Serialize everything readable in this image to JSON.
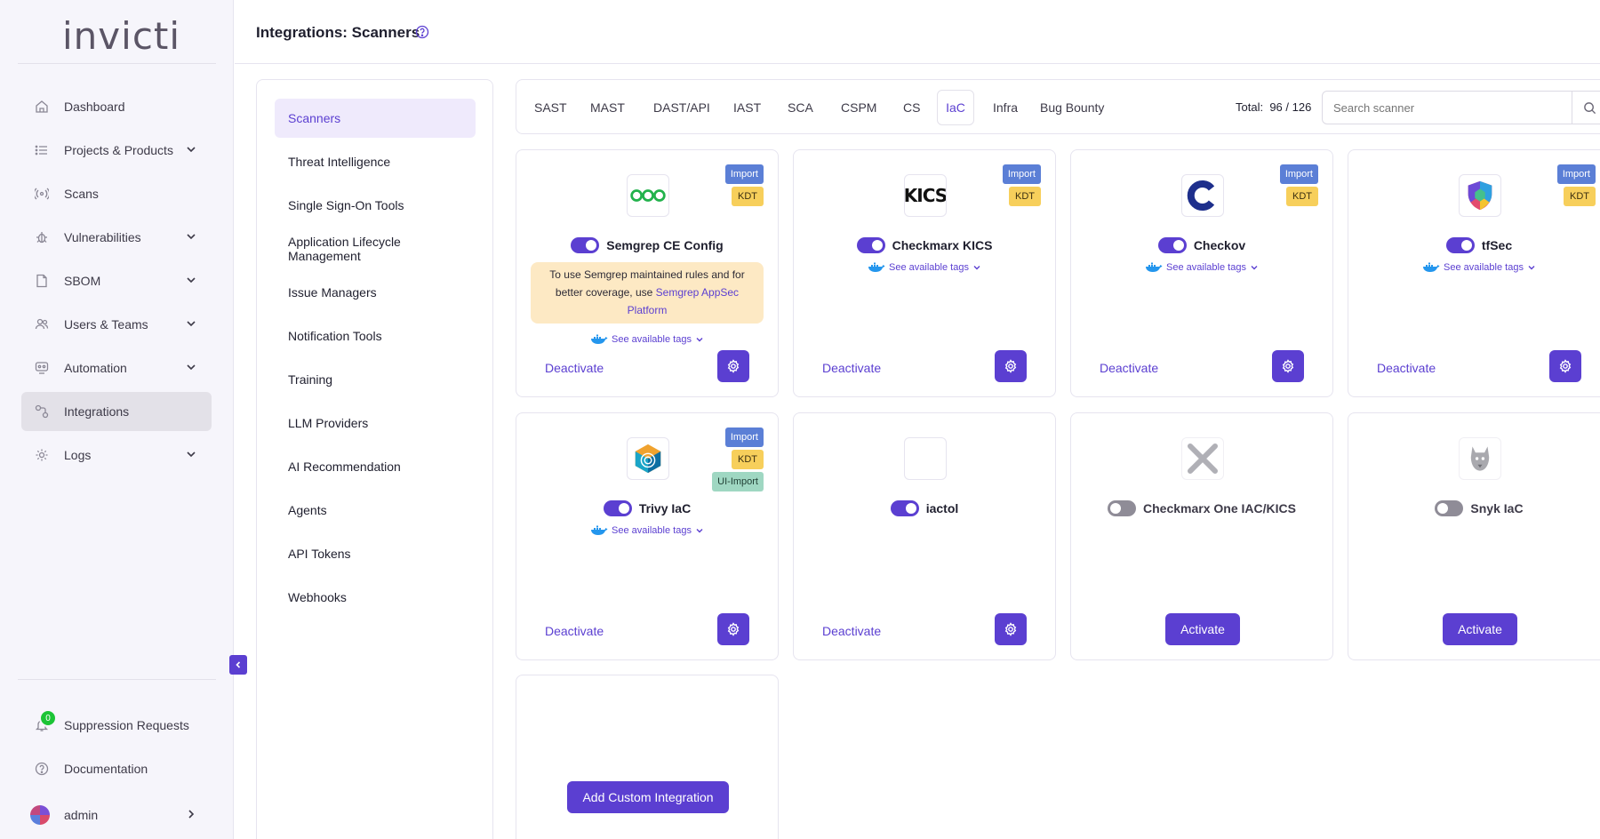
{
  "app": {
    "logo": "invicti"
  },
  "sidebar": {
    "items": [
      {
        "label": "Dashboard",
        "icon": "home-icon"
      },
      {
        "label": "Projects & Products",
        "icon": "list-icon",
        "expandable": true
      },
      {
        "label": "Scans",
        "icon": "radar-icon"
      },
      {
        "label": "Vulnerabilities",
        "icon": "bug-icon",
        "expandable": true
      },
      {
        "label": "SBOM",
        "icon": "document-icon",
        "expandable": true
      },
      {
        "label": "Users & Teams",
        "icon": "users-icon",
        "expandable": true
      },
      {
        "label": "Automation",
        "icon": "automation-icon",
        "expandable": true
      },
      {
        "label": "Integrations",
        "icon": "integrations-icon",
        "active": true
      },
      {
        "label": "Logs",
        "icon": "logs-icon",
        "expandable": true
      }
    ],
    "bottom": {
      "suppression": {
        "label": "Suppression Requests",
        "count": "0"
      },
      "documentation": {
        "label": "Documentation"
      },
      "user": {
        "label": "admin"
      }
    }
  },
  "header": {
    "title": "Integrations: Scanners"
  },
  "categories": [
    {
      "label": "Scanners",
      "active": true
    },
    {
      "label": "Threat Intelligence"
    },
    {
      "label": "Single Sign-On Tools"
    },
    {
      "label": "Application Lifecycle Management"
    },
    {
      "label": "Issue Managers"
    },
    {
      "label": "Notification Tools"
    },
    {
      "label": "Training"
    },
    {
      "label": "LLM Providers"
    },
    {
      "label": "AI Recommendation"
    },
    {
      "label": "Agents"
    },
    {
      "label": "API Tokens"
    },
    {
      "label": "Webhooks"
    }
  ],
  "tabs": [
    {
      "label": "SAST"
    },
    {
      "label": "MAST"
    },
    {
      "label": "DAST/API"
    },
    {
      "label": "IAST"
    },
    {
      "label": "SCA"
    },
    {
      "label": "CSPM"
    },
    {
      "label": "CS"
    },
    {
      "label": "IaC",
      "active": true
    },
    {
      "label": "Infra"
    },
    {
      "label": "Bug Bounty"
    }
  ],
  "total": {
    "label": "Total:",
    "value": "96 / 126"
  },
  "search": {
    "placeholder": "Search scanner"
  },
  "cards": [
    {
      "name": "Semgrep CE Config",
      "enabled": true,
      "tags": [
        "Import",
        "KDT"
      ],
      "notice_text": "To use Semgrep maintained rules and for better coverage, use ",
      "notice_link": "Semgrep AppSec Platform",
      "tags_link": "See available tags",
      "action": "Deactivate"
    },
    {
      "name": "Checkmarx KICS",
      "enabled": true,
      "tags": [
        "Import",
        "KDT"
      ],
      "tags_link": "See available tags",
      "action": "Deactivate"
    },
    {
      "name": "Checkov",
      "enabled": true,
      "tags": [
        "Import",
        "KDT"
      ],
      "tags_link": "See available tags",
      "action": "Deactivate"
    },
    {
      "name": "tfSec",
      "enabled": true,
      "tags": [
        "Import",
        "KDT"
      ],
      "tags_link": "See available tags",
      "action": "Deactivate"
    },
    {
      "name": "Trivy IaC",
      "enabled": true,
      "tags": [
        "Import",
        "KDT",
        "UI-Import"
      ],
      "tags_link": "See available tags",
      "action": "Deactivate"
    },
    {
      "name": "iactol",
      "enabled": true,
      "tags": [],
      "action": "Deactivate"
    },
    {
      "name": "Checkmarx One IAC/KICS",
      "enabled": false,
      "tags": [],
      "action": "Activate"
    },
    {
      "name": "Snyk IaC",
      "enabled": false,
      "tags": [],
      "action": "Activate"
    }
  ],
  "custom_integration": {
    "label": "Add Custom Integration"
  },
  "colors": {
    "accent": "#5b3fd1",
    "import_tag": "#5b7fd6",
    "kdt_tag": "#f7cf5b",
    "ui_import_tag": "#9fd7c2",
    "notice_bg": "#fde9c4"
  }
}
